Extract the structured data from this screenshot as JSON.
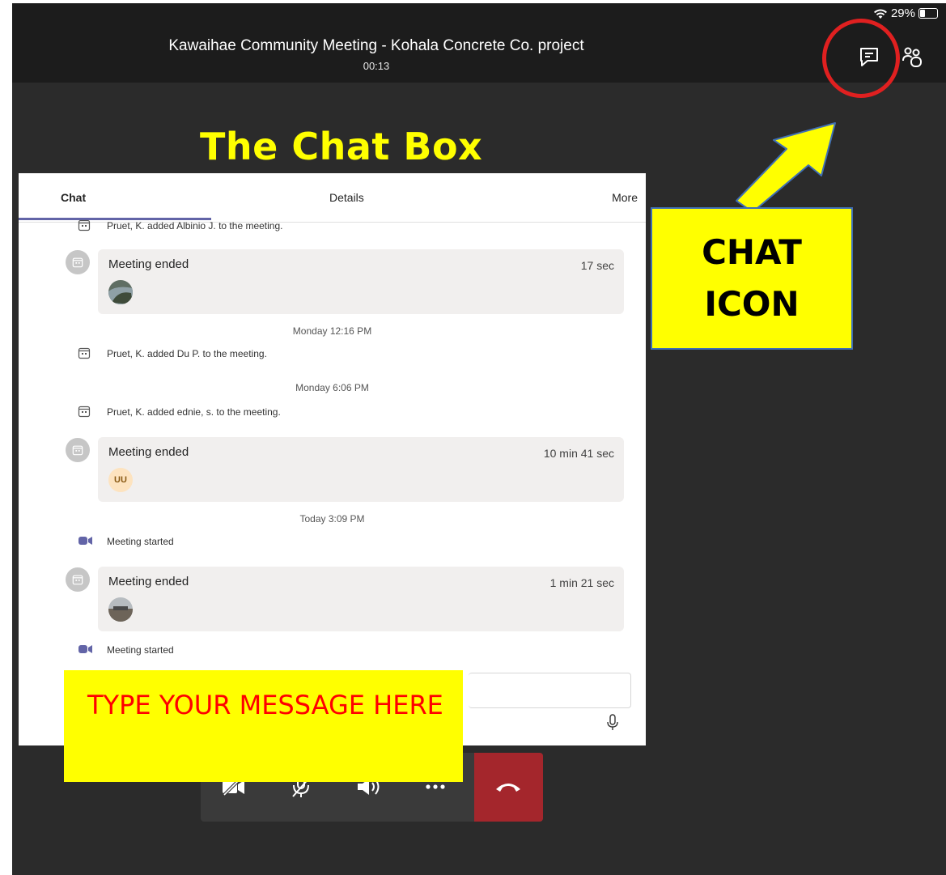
{
  "header": {
    "title": "Kawaihae Community Meeting - Kohala Concrete Co. project",
    "timer": "00:13",
    "battery": "29%"
  },
  "annotations": {
    "chat_box": "The Chat Box",
    "chat_icon": "CHAT ICON",
    "type_message": "TYPE YOUR MESSAGE HERE"
  },
  "tabs": {
    "chat": "Chat",
    "details": "Details",
    "more": "More"
  },
  "messages": {
    "m1": "Pruet, K. added Albinio J. to the meeting.",
    "e1": {
      "title": "Meeting ended",
      "duration": "17 sec"
    },
    "ts1": "Monday 12:16 PM",
    "m2": "Pruet, K. added Du P. to the meeting.",
    "ts2": "Monday 6:06 PM",
    "m3": "Pruet, K. added ednie, s. to the meeting.",
    "e2": {
      "title": "Meeting ended",
      "duration": "10 min 41 sec",
      "initials": "UU"
    },
    "ts3": "Today 3:09 PM",
    "s1": "Meeting started",
    "e3": {
      "title": "Meeting ended",
      "duration": "1 min 21 sec"
    },
    "s2": "Meeting started"
  },
  "colors": {
    "accent": "#6264a7",
    "hangup": "#a4262c",
    "highlight": "#ffff00",
    "annotation_red": "#ff0000"
  },
  "icons": [
    "chat-icon",
    "people-icon",
    "calendar-icon",
    "video-camera-icon",
    "mic-icon",
    "video-off-icon",
    "mic-off-icon",
    "speaker-icon",
    "more-icon",
    "hang-up-icon"
  ]
}
